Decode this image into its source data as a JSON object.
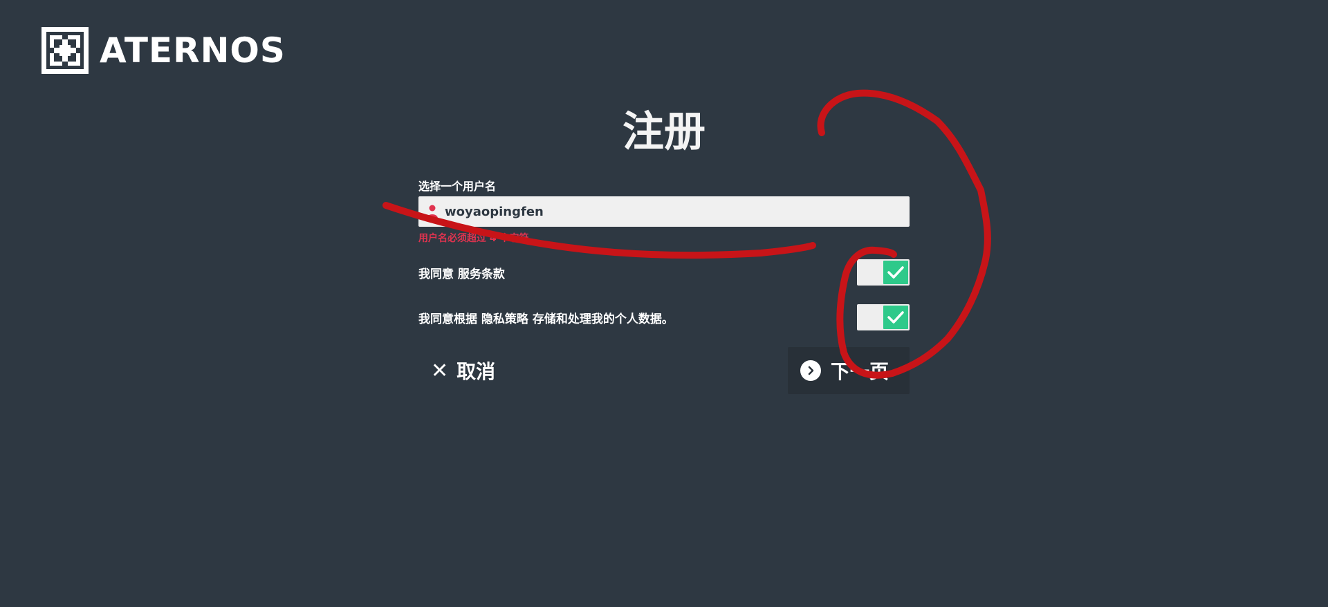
{
  "brand": {
    "name": "ATERNOS",
    "logo_icon": "aternos-logo-icon"
  },
  "page": {
    "title": "注册"
  },
  "form": {
    "username_label": "选择一个用户名",
    "username_value": "woyaopingfen",
    "username_icon": "user-icon",
    "username_error": "用户名必须超过 4 个字符",
    "terms_text": "我同意 ",
    "terms_link": "服务条款",
    "terms_checked": true,
    "privacy_prefix": "我同意根据 ",
    "privacy_link": "隐私策略",
    "privacy_suffix": " 存储和处理我的个人数据。",
    "privacy_checked": true
  },
  "buttons": {
    "cancel_label": "取消",
    "cancel_icon": "close-icon",
    "next_label": "下一页",
    "next_icon": "chevron-right-circle-icon"
  },
  "colors": {
    "background": "#2e3842",
    "accent_green": "#2ec98a",
    "error_red": "#e0334f",
    "annotation_red": "#c81418"
  }
}
